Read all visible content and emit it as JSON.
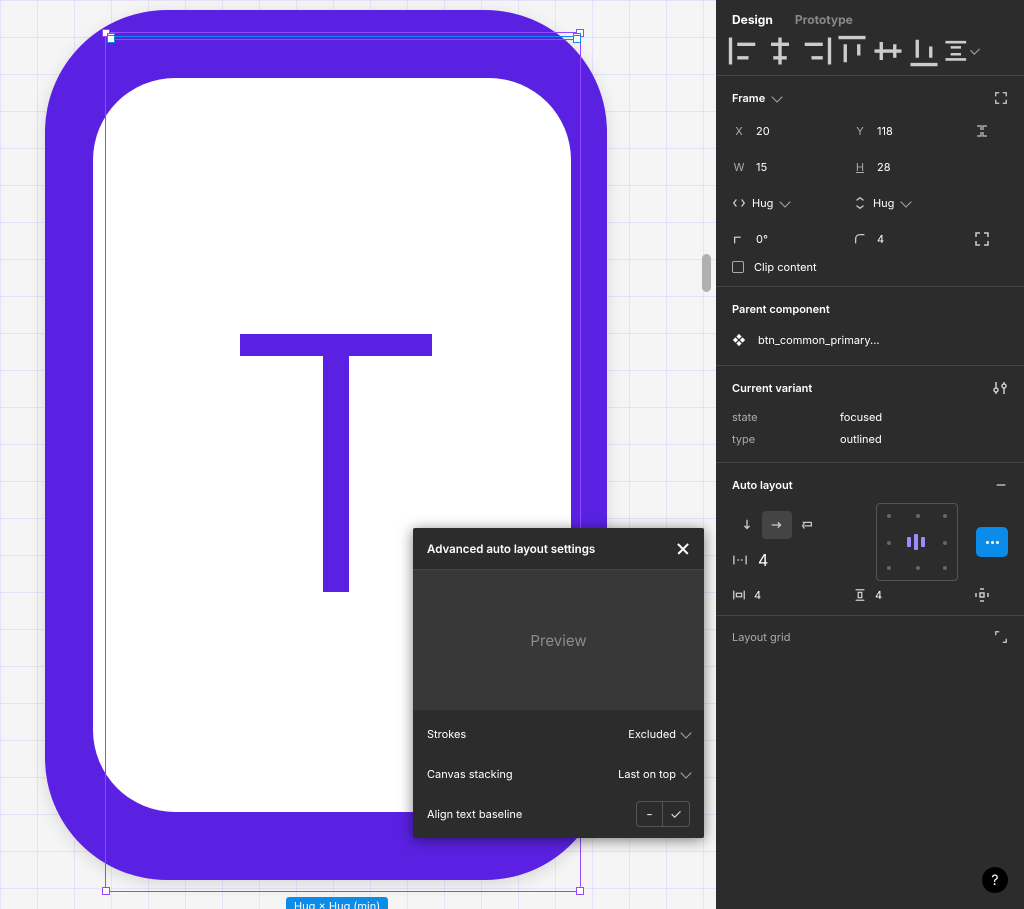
{
  "tabs": {
    "design": "Design",
    "prototype": "Prototype",
    "active": "design"
  },
  "frame": {
    "title": "Frame",
    "x": {
      "label": "X",
      "value": "20"
    },
    "y": {
      "label": "Y",
      "value": "118"
    },
    "w": {
      "label": "W",
      "value": "15"
    },
    "h": {
      "label": "H",
      "value": "28"
    },
    "hug_w": "Hug",
    "hug_h": "Hug",
    "rotation": "0°",
    "radius": "4",
    "clip": "Clip content"
  },
  "parent": {
    "title": "Parent component",
    "name": "btn_common_primary..."
  },
  "variant": {
    "title": "Current variant",
    "state": {
      "k": "state",
      "v": "focused"
    },
    "type": {
      "k": "type",
      "v": "outlined"
    }
  },
  "autolayout": {
    "title": "Auto layout",
    "gap": "4",
    "padh": "4",
    "padv": "4"
  },
  "layoutgrid": {
    "title": "Layout grid"
  },
  "popup": {
    "title": "Advanced auto layout settings",
    "preview": "Preview",
    "strokes": {
      "label": "Strokes",
      "value": "Excluded"
    },
    "stacking": {
      "label": "Canvas stacking",
      "value": "Last on top"
    },
    "baseline": {
      "label": "Align text baseline",
      "off": "-",
      "on": "✓"
    }
  },
  "canvas": {
    "pill": "Hug × Hug (min)"
  },
  "help": "?"
}
